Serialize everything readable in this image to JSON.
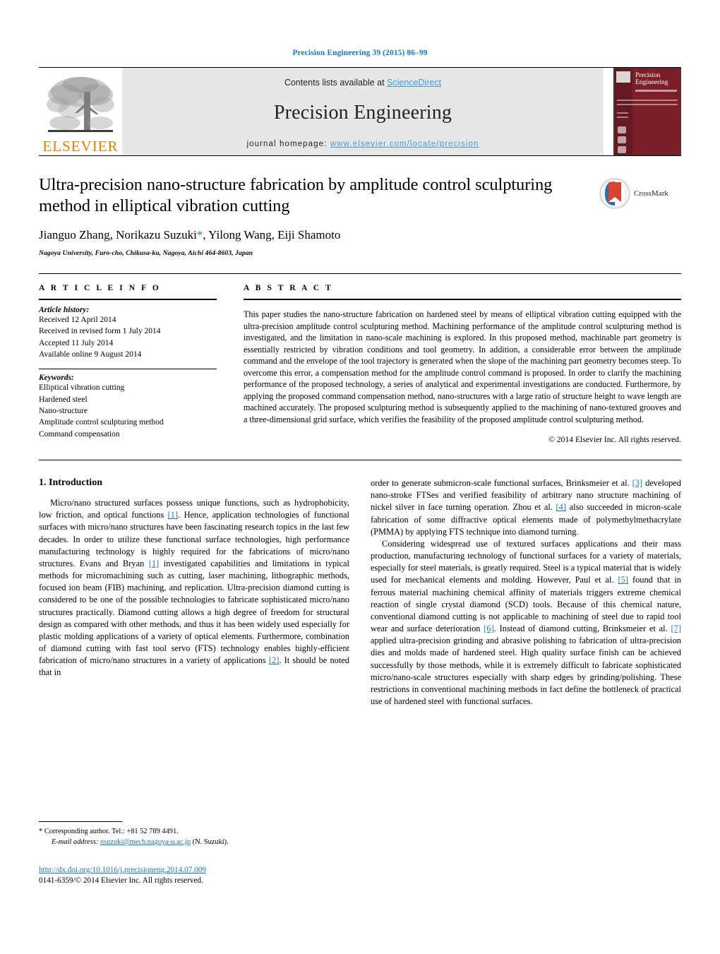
{
  "running_head": "Precision Engineering 39 (2015) 86–99",
  "masthead": {
    "contents_prefix": "Contents lists available at ",
    "sciencedirect": "ScienceDirect",
    "journal_title": "Precision Engineering",
    "homepage_prefix": "journal homepage:",
    "homepage_url": "www.elsevier.com/locate/precision",
    "publisher": "ELSEVIER",
    "cover_title": "Precision Engineering",
    "accent_link": "#3f9bd0",
    "publisher_color": "#ef7c00",
    "cover_color": "#7c1f29"
  },
  "article": {
    "title": "Ultra-precision nano-structure fabrication by amplitude control sculpturing method in elliptical vibration cutting",
    "authors": "Jianguo Zhang, Norikazu Suzuki",
    "authors_tail": ", Yilong Wang, Eiji Shamoto",
    "corresponding_marker": "*",
    "affiliation": "Nagoya University, Furo-cho, Chikusa-ku, Nagoya, Aichi 464-8603, Japan",
    "crossmark_label": "CrossMark"
  },
  "article_info": {
    "heading": "A R T I C L E   I N F O",
    "history_label": "Article history:",
    "history": [
      "Received 12 April 2014",
      "Received in revised form 1 July 2014",
      "Accepted 11 July 2014",
      "Available online 9 August 2014"
    ],
    "keywords_label": "Keywords:",
    "keywords": [
      "Elliptical vibration cutting",
      "Hardened steel",
      "Nano-structure",
      "Amplitude control sculpturing method",
      "Command compensation"
    ]
  },
  "abstract": {
    "heading": "A B S T R A C T",
    "text": "This paper studies the nano-structure fabrication on hardened steel by means of elliptical vibration cutting equipped with the ultra-precision amplitude control sculpturing method. Machining performance of the amplitude control sculpturing method is investigated, and the limitation in nano-scale machining is explored. In this proposed method, machinable part geometry is essentially restricted by vibration conditions and tool geometry. In addition, a considerable error between the amplitude command and the envelope of the tool trajectory is generated when the slope of the machining part geometry becomes steep. To overcome this error, a compensation method for the amplitude control command is proposed. In order to clarify the machining performance of the proposed technology, a series of analytical and experimental investigations are conducted. Furthermore, by applying the proposed command compensation method, nano-structures with a large ratio of structure height to wave length are machined accurately. The proposed sculpturing method is subsequently applied to the machining of nano-textured grooves and a three-dimensional grid surface, which verifies the feasibility of the proposed amplitude control sculpturing method.",
    "copyright": "© 2014 Elsevier Inc. All rights reserved."
  },
  "body": {
    "section_heading": "1.  Introduction",
    "left_paragraphs": [
      "Micro/nano structured surfaces possess unique functions, such as hydrophobicity, low friction, and optical functions [1]. Hence, application technologies of functional surfaces with micro/nano structures have been fascinating research topics in the last few decades. In order to utilize these functional surface technologies, high performance manufacturing technology is highly required for the fabrications of micro/nano structures. Evans and Bryan [1] investigated capabilities and limitations in typical methods for micromachining such as cutting, laser machining, lithographic methods, focused ion beam (FIB) machining, and replication. Ultra-precision diamond cutting is considered to be one of the possible technologies to fabricate sophisticated micro/nano structures practically. Diamond cutting allows a high degree of freedom for structural design as compared with other methods, and thus it has been widely used especially for plastic molding applications of a variety of optical elements. Furthermore, combination of diamond cutting with fast tool servo (FTS) technology enables highly-efficient fabrication of micro/nano structures in a variety of applications [2]. It should be noted that in"
    ],
    "right_paragraphs": [
      "order to generate submicron-scale functional surfaces, Brinksmeier et al. [3] developed nano-stroke FTSes and verified feasibility of arbitrary nano structure machining of nickel silver in face turning operation. Zhou et al. [4] also succeeded in micron-scale fabrication of some diffractive optical elements made of polymethylmethacrylate (PMMA) by applying FTS technique into diamond turning.",
      "Considering widespread use of textured surfaces applications and their mass production, manufacturing technology of functional surfaces for a variety of materials, especially for steel materials, is greatly required. Steel is a typical material that is widely used for mechanical elements and molding. However, Paul et al. [5] found that in ferrous material machining chemical affinity of materials triggers extreme chemical reaction of single crystal diamond (SCD) tools. Because of this chemical nature, conventional diamond cutting is not applicable to machining of steel due to rapid tool wear and surface deterioration [6]. Instead of diamond cutting, Brinksmeier et al. [7] applied ultra-precision grinding and abrasive polishing to fabrication of ultra-precision dies and molds made of hardened steel. High quality surface finish can be achieved successfully by those methods, while it is extremely difficult to fabricate sophisticated micro/nano-scale structures especially with sharp edges by grinding/polishing. These restrictions in conventional machining methods in fact define the bottleneck of practical use of hardened steel with functional surfaces."
    ]
  },
  "footer": {
    "corresponding_star": "*",
    "corresponding_text": "Corresponding author. Tel.: +81 52 789 4491.",
    "email_label": "E-mail address:",
    "email": "nsuzuki@mech.nagoya-u.ac.jp",
    "email_suffix": "(N. Suzuki).",
    "doi": "http://dx.doi.org/10.1016/j.precisioneng.2014.07.009",
    "issn": "0141-6359/© 2014 Elsevier Inc. All rights reserved."
  }
}
